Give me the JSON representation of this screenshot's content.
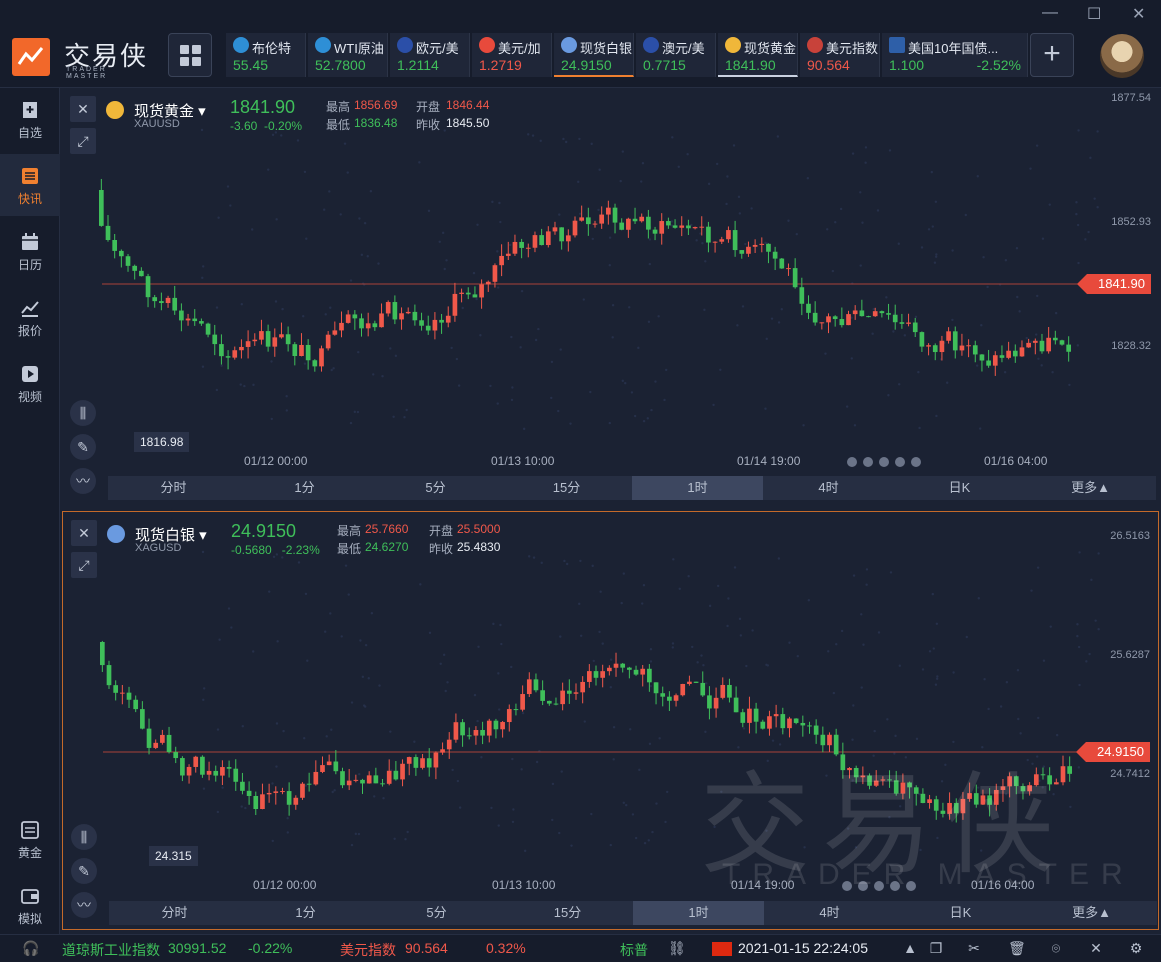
{
  "app": {
    "logo_text": "交易侠",
    "logo_sub": "TRADER MASTER"
  },
  "tickers": [
    {
      "name": "布伦特",
      "value": "55.45",
      "color": "#3fbf5a",
      "icon": "oil-icon"
    },
    {
      "name": "WTI原油",
      "value": "52.7800",
      "color": "#3fbf5a",
      "icon": "oil-icon"
    },
    {
      "name": "欧元/美",
      "value": "1.2114",
      "color": "#3fbf5a",
      "icon": "eu-flag-icon"
    },
    {
      "name": "美元/加",
      "value": "1.2719",
      "color": "#f0584a",
      "icon": "ca-flag-icon"
    },
    {
      "name": "现货白银",
      "value": "24.9150",
      "color": "#3fbf5a",
      "icon": "silver-icon"
    },
    {
      "name": "澳元/美",
      "value": "0.7715",
      "color": "#3fbf5a",
      "icon": "au-flag-icon"
    },
    {
      "name": "现货黄金",
      "value": "1841.90",
      "color": "#3fbf5a",
      "icon": "gold-icon"
    },
    {
      "name": "美元指数",
      "value": "90.564",
      "color": "#f0584a",
      "icon": "us-flag-icon"
    },
    {
      "name": "美国10年国债...",
      "value": "1.100",
      "pct": "-2.52%",
      "color": "#3fbf5a",
      "icon": "bond-icon"
    }
  ],
  "sidebar": [
    {
      "label": "自选"
    },
    {
      "label": "快讯"
    },
    {
      "label": "日历"
    },
    {
      "label": "报价"
    },
    {
      "label": "视频"
    },
    {
      "label": "黄金"
    },
    {
      "label": "模拟"
    }
  ],
  "gold": {
    "title": "现货黄金",
    "code": "XAUUSD",
    "price": "1841.90",
    "chg": "-3.60",
    "pct": "-0.20%",
    "high_label": "最高",
    "high": "1856.69",
    "open_label": "开盘",
    "open": "1846.44",
    "low_label": "最低",
    "low": "1836.48",
    "prev_label": "昨收",
    "prev": "1845.50",
    "y_ticks": [
      "1877.54",
      "1852.93",
      "1828.32"
    ],
    "price_tag": "1841.90",
    "low_tag": "1816.98",
    "x_ticks": [
      "01/12 00:00",
      "01/13 10:00",
      "01/14 19:00",
      "01/16 04:00"
    ]
  },
  "silver": {
    "title": "现货白银",
    "code": "XAGUSD",
    "price": "24.9150",
    "chg": "-0.5680",
    "pct": "-2.23%",
    "high_label": "最高",
    "high": "25.7660",
    "open_label": "开盘",
    "open": "25.5000",
    "low_label": "最低",
    "low": "24.6270",
    "prev_label": "昨收",
    "prev": "25.4830",
    "y_ticks": [
      "26.5163",
      "25.6287",
      "24.7412"
    ],
    "price_tag": "24.9150",
    "low_tag": "24.315",
    "x_ticks": [
      "01/12 00:00",
      "01/13 10:00",
      "01/14 19:00",
      "01/16 04:00"
    ]
  },
  "timeframes": [
    "分时",
    "1分",
    "5分",
    "15分",
    "1时",
    "4时",
    "日K",
    "更多▲"
  ],
  "watermark": {
    "main": "交易侠",
    "sub": "TRADER MASTER"
  },
  "status": {
    "dow_label": "道琼斯工业指数",
    "dow_value": "30991.52",
    "dow_pct": "-0.22%",
    "usd_label": "美元指数",
    "usd_value": "90.564",
    "usd_pct": "0.32%",
    "sp_label": "标普",
    "datetime": "2021-01-15 22:24:05"
  }
}
